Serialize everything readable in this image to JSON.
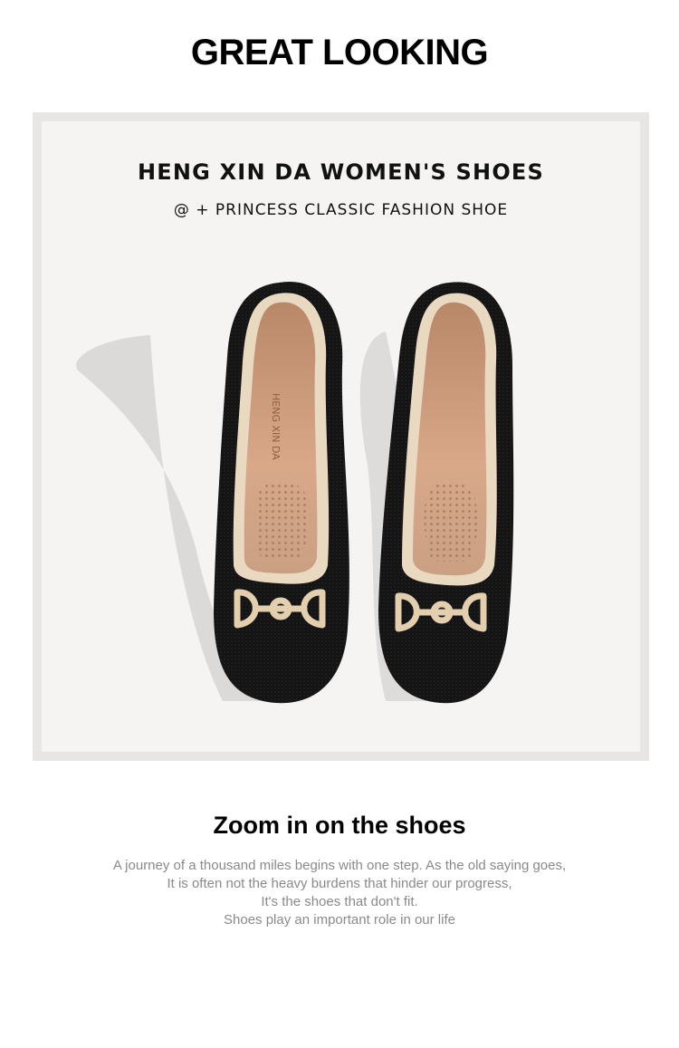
{
  "headline": "GREAT LOOKING",
  "photo": {
    "title": "HENG XIN DA WOMEN'S SHOES",
    "subtitle": "@ + PRINCESS CLASSIC FASHION SHOE",
    "insole_brand": "HENG XIN DA"
  },
  "section": {
    "title": "Zoom in on the shoes",
    "lines": [
      "A journey of a thousand miles begins with one step. As the old saying goes,",
      "It is often not the heavy burdens that hinder our progress,",
      "It's the shoes that don't fit.",
      "Shoes play an important role in our life"
    ]
  },
  "colors": {
    "shoe_body": "#141414",
    "piping": "#ead9c1",
    "insole": "#c99a7a",
    "buckle": "#e3cfae"
  }
}
